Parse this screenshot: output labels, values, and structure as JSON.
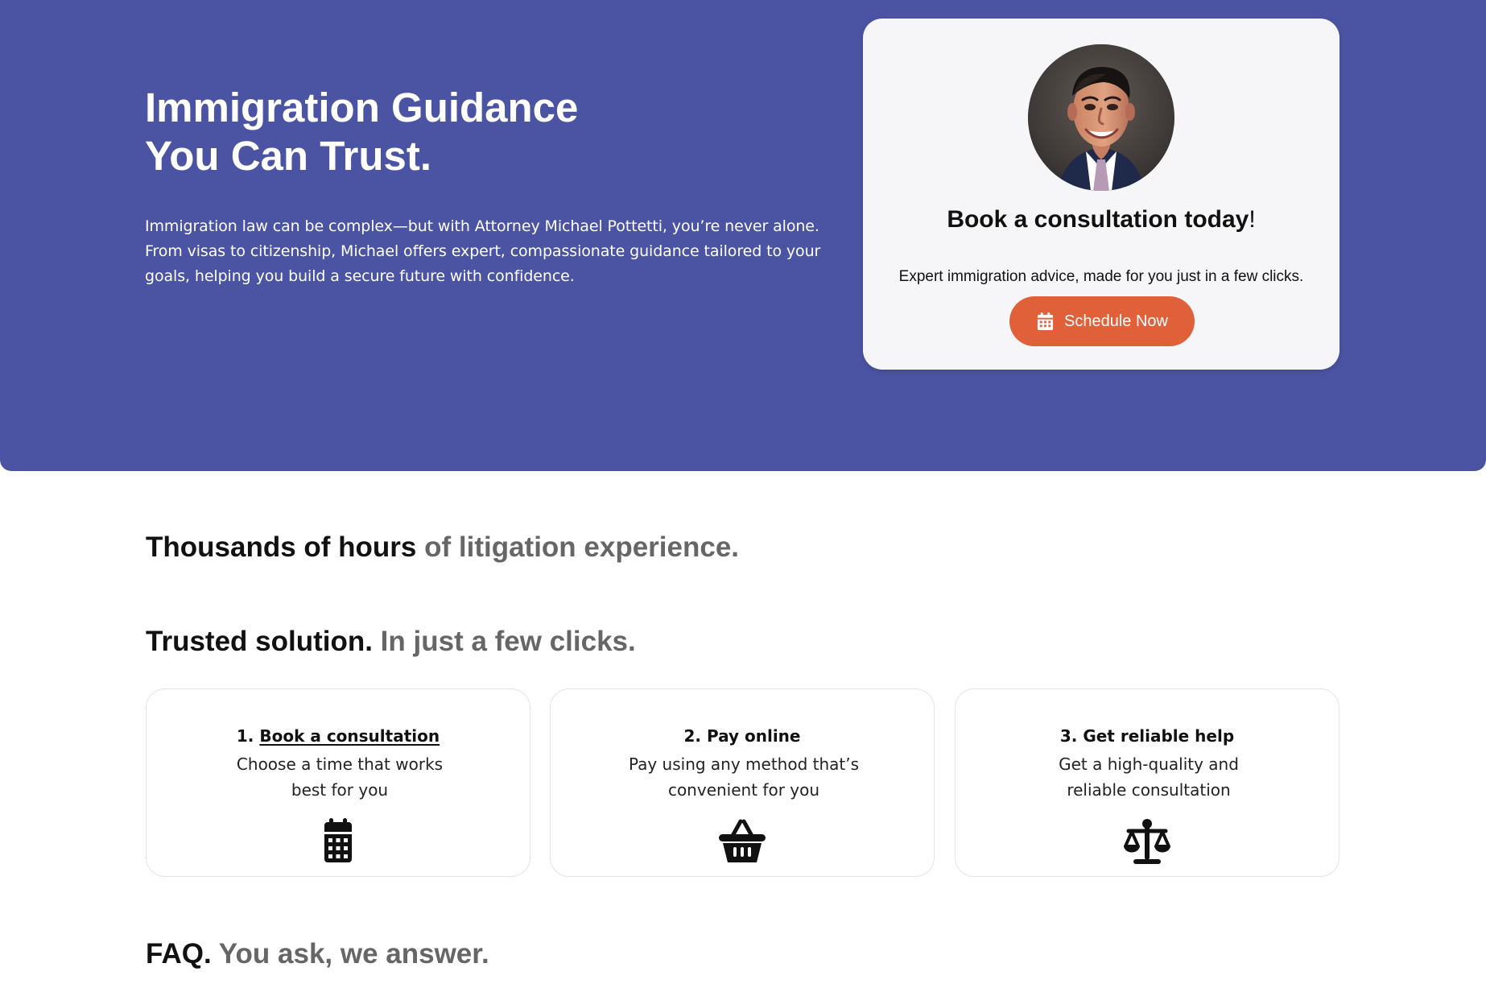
{
  "hero": {
    "title_line_1": "Immigration Guidance",
    "title_line_2": "You Can Trust.",
    "description": "Immigration law can be complex—but with Attorney Michael Pottetti, you’re never alone. From visas to citizenship, Michael offers expert, compassionate guidance tailored to your goals, helping you build a secure future with confidence."
  },
  "consultation_card": {
    "title_main": "Book a consultation today",
    "title_punctuation": "!",
    "subtitle": "Expert immigration advice, made for you just in a few clicks.",
    "button_label": "Schedule Now",
    "button_icon": "calendar-icon",
    "avatar_description": "attorney portrait"
  },
  "sections": {
    "experience": {
      "strong": "Thousands of hours",
      "muted": " of litigation experience."
    },
    "solution": {
      "strong": "Trusted solution.",
      "muted": " In just a few clicks."
    },
    "faq": {
      "strong": "FAQ.",
      "muted": " You ask, we answer."
    }
  },
  "steps": [
    {
      "number": "1. ",
      "title": "Book a consultation",
      "description": "Choose a time that works best for you",
      "icon": "calendar-icon"
    },
    {
      "number": "2. ",
      "title": "Pay online",
      "description": "Pay using any method that’s convenient for you",
      "icon": "basket-icon"
    },
    {
      "number": "3. ",
      "title": "Get reliable help",
      "description": "Get a high-quality and reliable consultation",
      "icon": "scale-icon"
    }
  ],
  "colors": {
    "hero_background": "#4b54a3",
    "button_background": "#e06039",
    "card_background": "#f6f6f8",
    "muted_heading": "#666666"
  }
}
